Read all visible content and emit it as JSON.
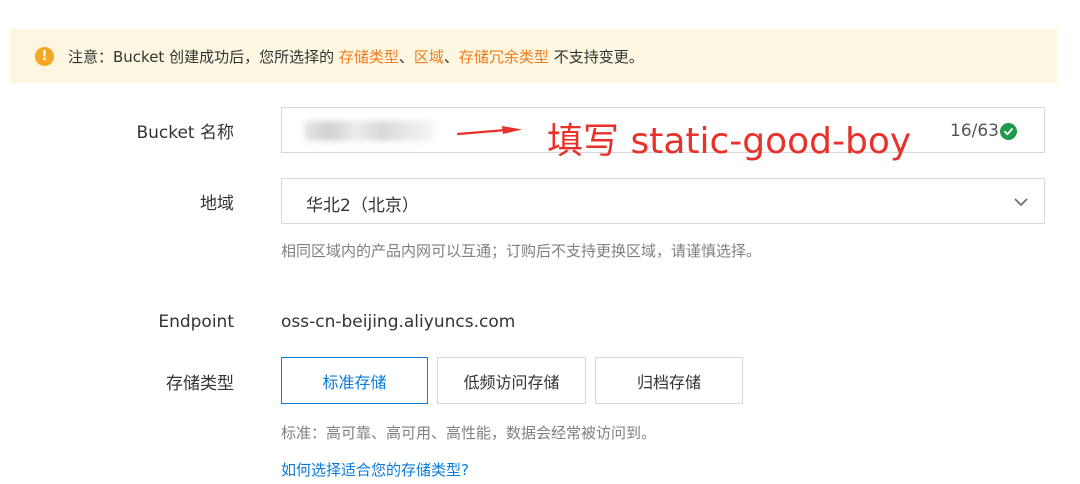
{
  "notice": {
    "prefix": "注意：Bucket 创建成功后，您所选择的 ",
    "highlight_storage_type": "存储类型",
    "sep1": "、",
    "highlight_region": "区域",
    "sep2": "、",
    "highlight_redundancy": "存储冗余类型",
    "suffix": " 不支持变更。"
  },
  "bucket_name": {
    "label": "Bucket 名称",
    "counter": "16/63",
    "annotation": "填写 static-good-boy"
  },
  "region": {
    "label": "地域",
    "value": "华北2（北京）",
    "hint": "相同区域内的产品内网可以互通；订购后不支持更换区域，请谨慎选择。"
  },
  "endpoint": {
    "label": "Endpoint",
    "value": "oss-cn-beijing.aliyuncs.com"
  },
  "storage_type": {
    "label": "存储类型",
    "options": [
      "标准存储",
      "低频访问存储",
      "归档存储"
    ],
    "selected": "标准存储",
    "hint": "标准：高可靠、高可用、高性能，数据会经常被访问到。",
    "help_link": "如何选择适合您的存储类型?"
  },
  "colors": {
    "accent": "#0a7bd8",
    "warning": "#f5a623",
    "highlight": "#f07d20",
    "annotation": "#e8312a",
    "success": "#1e9b4d",
    "notice_bg": "#fdf6e0"
  },
  "icons": {
    "warning": "warning-icon",
    "valid": "check-circle-icon",
    "dropdown": "chevron-down-icon",
    "annotation_arrow": "arrow-right-icon"
  }
}
